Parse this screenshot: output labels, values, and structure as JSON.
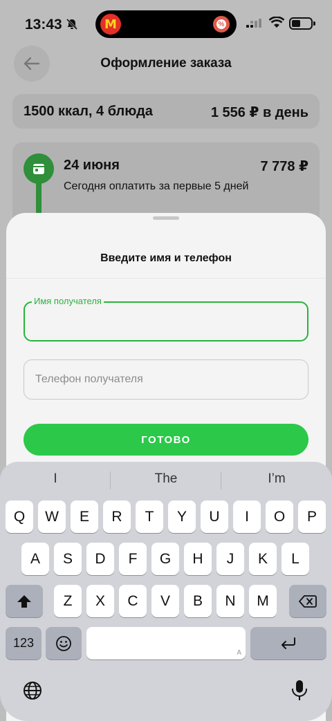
{
  "status_bar": {
    "time": "13:43",
    "app_icon_letter": "M",
    "badge_symbol": "%"
  },
  "header": {
    "title": "Оформление заказа"
  },
  "summary": {
    "plan": "1500 ккал, 4 блюда",
    "price_per_day": "1 556 ₽ в день"
  },
  "delivery": {
    "date": "24 июня",
    "amount": "7 778 ₽",
    "note": "Сегодня оплатить за первые 5 дней"
  },
  "sheet": {
    "title": "Введите имя и телефон",
    "name_field": {
      "label": "Имя получателя",
      "value": "",
      "placeholder": ""
    },
    "phone_field": {
      "value": "",
      "placeholder": "Телефон получателя"
    },
    "ready_button": "ГОТОВО"
  },
  "keyboard": {
    "suggestions": [
      "I",
      "The",
      "I’m"
    ],
    "row1": [
      "Q",
      "W",
      "E",
      "R",
      "T",
      "Y",
      "U",
      "I",
      "O",
      "P"
    ],
    "row2": [
      "A",
      "S",
      "D",
      "F",
      "G",
      "H",
      "J",
      "K",
      "L"
    ],
    "row3": [
      "Z",
      "X",
      "C",
      "V",
      "B",
      "N",
      "M"
    ],
    "numbers_key": "123",
    "space_corner": "A"
  },
  "colors": {
    "accent_green": "#2cc84a",
    "focus_green": "#27b43a",
    "timeline_green": "#2f8f3a"
  }
}
